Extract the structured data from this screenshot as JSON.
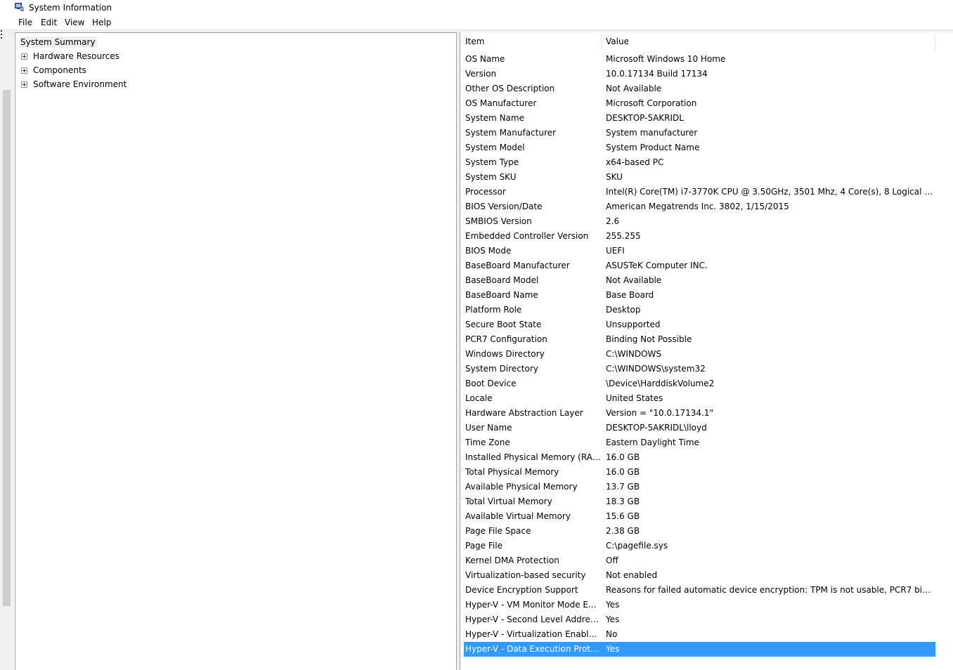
{
  "window": {
    "title": "System Information"
  },
  "menu": {
    "items": [
      "File",
      "Edit",
      "View",
      "Help"
    ]
  },
  "tree": {
    "root": "System Summary",
    "children": [
      "Hardware Resources",
      "Components",
      "Software Environment"
    ]
  },
  "table": {
    "columns": [
      "Item",
      "Value"
    ],
    "selected_index": 40,
    "rows": [
      {
        "item": "OS Name",
        "value": "Microsoft Windows 10 Home"
      },
      {
        "item": "Version",
        "value": "10.0.17134 Build 17134"
      },
      {
        "item": "Other OS Description",
        "value": "Not Available"
      },
      {
        "item": "OS Manufacturer",
        "value": "Microsoft Corporation"
      },
      {
        "item": "System Name",
        "value": "DESKTOP-5AKRIDL"
      },
      {
        "item": "System Manufacturer",
        "value": "System manufacturer"
      },
      {
        "item": "System Model",
        "value": "System Product Name"
      },
      {
        "item": "System Type",
        "value": "x64-based PC"
      },
      {
        "item": "System SKU",
        "value": "SKU"
      },
      {
        "item": "Processor",
        "value": "Intel(R) Core(TM) i7-3770K CPU @ 3.50GHz, 3501 Mhz, 4 Core(s), 8 Logical Pr..."
      },
      {
        "item": "BIOS Version/Date",
        "value": "American Megatrends Inc. 3802, 1/15/2015"
      },
      {
        "item": "SMBIOS Version",
        "value": "2.6"
      },
      {
        "item": "Embedded Controller Version",
        "value": "255.255"
      },
      {
        "item": "BIOS Mode",
        "value": "UEFI"
      },
      {
        "item": "BaseBoard Manufacturer",
        "value": "ASUSTeK Computer INC."
      },
      {
        "item": "BaseBoard Model",
        "value": "Not Available"
      },
      {
        "item": "BaseBoard Name",
        "value": "Base Board"
      },
      {
        "item": "Platform Role",
        "value": "Desktop"
      },
      {
        "item": "Secure Boot State",
        "value": "Unsupported"
      },
      {
        "item": "PCR7 Configuration",
        "value": "Binding Not Possible"
      },
      {
        "item": "Windows Directory",
        "value": "C:\\WINDOWS"
      },
      {
        "item": "System Directory",
        "value": "C:\\WINDOWS\\system32"
      },
      {
        "item": "Boot Device",
        "value": "\\Device\\HarddiskVolume2"
      },
      {
        "item": "Locale",
        "value": "United States"
      },
      {
        "item": "Hardware Abstraction Layer",
        "value": "Version = \"10.0.17134.1\""
      },
      {
        "item": "User Name",
        "value": "DESKTOP-5AKRIDL\\lloyd"
      },
      {
        "item": "Time Zone",
        "value": "Eastern Daylight Time"
      },
      {
        "item": "Installed Physical Memory (RAM)",
        "value": "16.0 GB"
      },
      {
        "item": "Total Physical Memory",
        "value": "16.0 GB"
      },
      {
        "item": "Available Physical Memory",
        "value": "13.7 GB"
      },
      {
        "item": "Total Virtual Memory",
        "value": "18.3 GB"
      },
      {
        "item": "Available Virtual Memory",
        "value": "15.6 GB"
      },
      {
        "item": "Page File Space",
        "value": "2.38 GB"
      },
      {
        "item": "Page File",
        "value": "C:\\pagefile.sys"
      },
      {
        "item": "Kernel DMA Protection",
        "value": "Off"
      },
      {
        "item": "Virtualization-based security",
        "value": "Not enabled"
      },
      {
        "item": "Device Encryption Support",
        "value": "Reasons for failed automatic device encryption: TPM is not usable, PCR7 bindi..."
      },
      {
        "item": "Hyper-V - VM Monitor Mode E...",
        "value": "Yes"
      },
      {
        "item": "Hyper-V - Second Level Addres...",
        "value": "Yes"
      },
      {
        "item": "Hyper-V - Virtualization Enable...",
        "value": "No"
      },
      {
        "item": "Hyper-V - Data Execution Prote...",
        "value": "Yes"
      }
    ]
  },
  "icons": {
    "app": "system-info-icon",
    "expand": "plus-box-icon"
  },
  "colors": {
    "selection": "#3399ff",
    "panel_bg": "#f0f0f0"
  }
}
